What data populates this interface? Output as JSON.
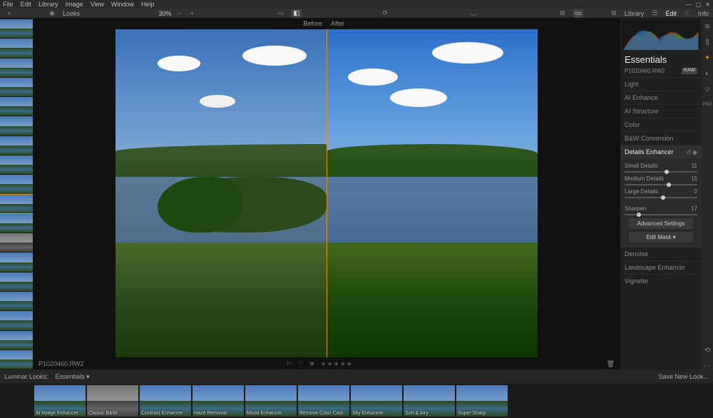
{
  "menubar": {
    "items": [
      "File",
      "Edit",
      "Library",
      "Image",
      "View",
      "Window",
      "Help"
    ]
  },
  "toolbar": {
    "looks_label": "Looks",
    "zoom": "30%",
    "library_label": "Library",
    "edit_label": "Edit",
    "info_label": "Info"
  },
  "compare": {
    "before": "Before",
    "after": "After"
  },
  "status": {
    "filename": "P1020460.RW2",
    "trash_icon": "trash"
  },
  "panel": {
    "title": "Essentials",
    "filename": "P1020460.RW2",
    "raw_tag": "RAW",
    "sections": [
      "Light",
      "AI Enhance",
      "AI Structure",
      "Color",
      "B&W Conversion"
    ],
    "active_section": "Details Enhancer",
    "sliders": [
      {
        "label": "Small Details",
        "value": 11,
        "pos": 55
      },
      {
        "label": "Medium Details",
        "value": 15,
        "pos": 58
      },
      {
        "label": "Large Details",
        "value": 0,
        "pos": 50
      }
    ],
    "sharpen": {
      "label": "Sharpen",
      "value": 17,
      "pos": 17
    },
    "adv_btn": "Advanced Settings",
    "mask_btn": "Edit Mask ▾",
    "sections_after": [
      "Denoise",
      "Landscape Enhancer",
      "Vignette"
    ]
  },
  "looks_bar": {
    "title": "Luminar Looks:",
    "collection": "Essentials ▾",
    "save": "Save New Look..."
  },
  "looks": [
    {
      "name": "AI Image Enhancer"
    },
    {
      "name": "Classic B&W",
      "bw": true
    },
    {
      "name": "Contrast Enhancer"
    },
    {
      "name": "Haze Removal"
    },
    {
      "name": "Mood Enhancer"
    },
    {
      "name": "Remove Color Cast"
    },
    {
      "name": "Sky Enhancer"
    },
    {
      "name": "Soft & Airy"
    },
    {
      "name": "Super Sharp"
    }
  ],
  "rail_icons": [
    "layers",
    "star",
    "sun",
    "smile",
    "pro"
  ]
}
